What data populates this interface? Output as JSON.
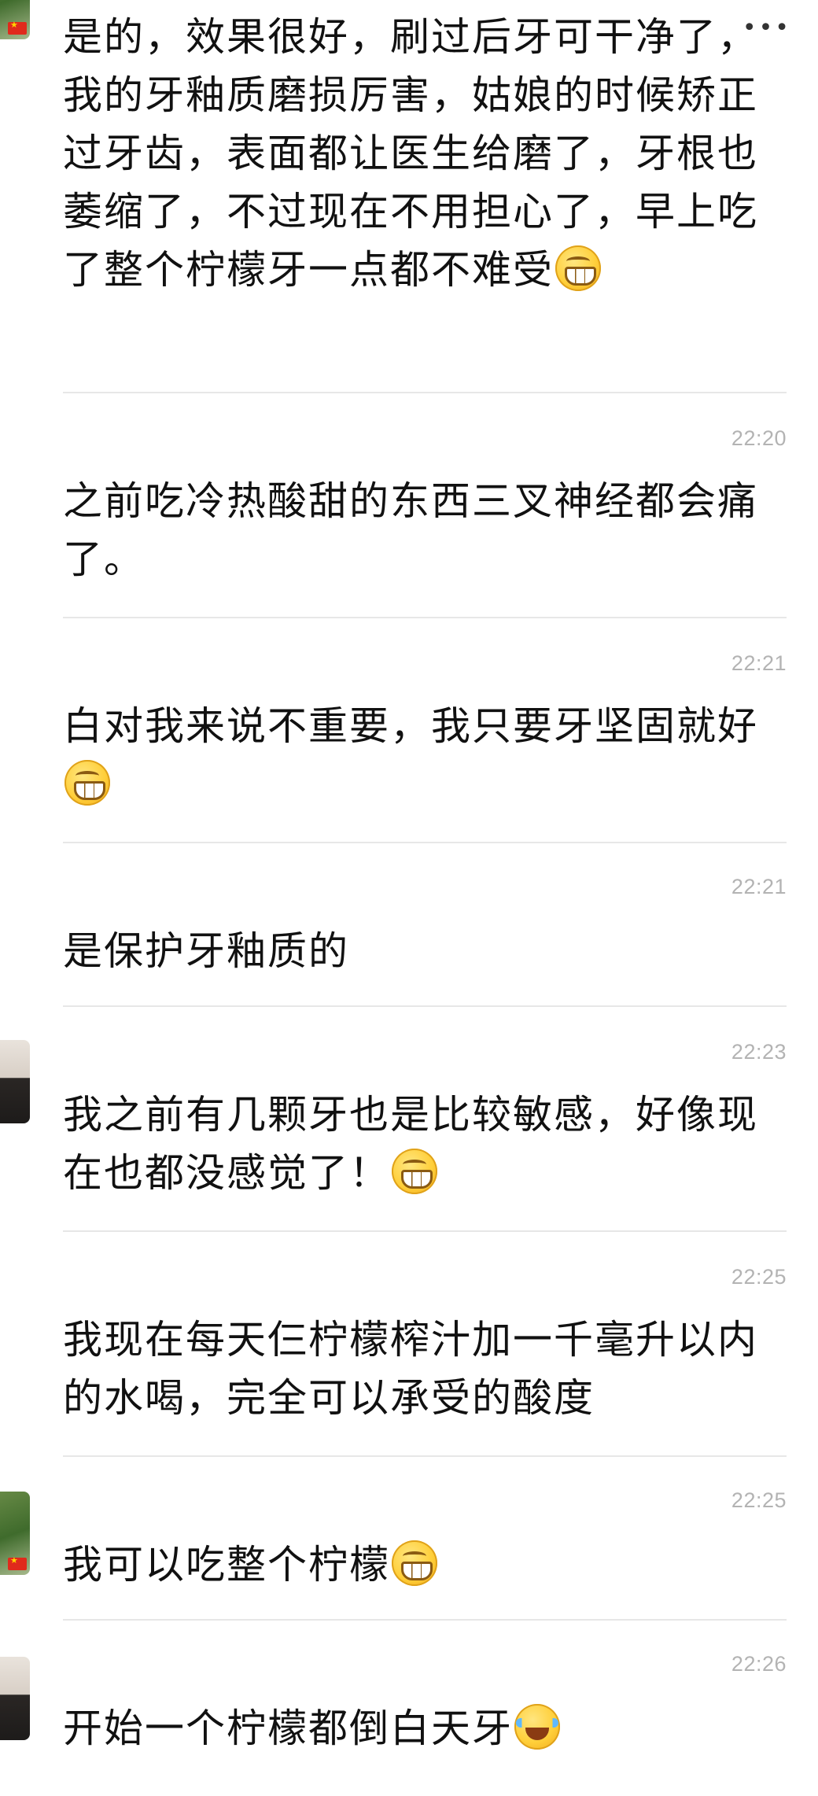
{
  "messages": [
    {
      "avatar": "plant-flag-avatar",
      "time": "",
      "text": "是的，效果很好，刷过后牙可干净了，我的牙釉质磨损厉害，姑娘的时候矫正过牙齿，表面都让医生给磨了，牙根也萎缩了，不过现在不用担心了，早上吃了整个柠檬牙一点都不难受",
      "emoji": "grin"
    },
    {
      "avatar": "",
      "time": "22:20",
      "text": "之前吃冷热酸甜的东西三叉神经都会痛了。",
      "emoji": ""
    },
    {
      "avatar": "",
      "time": "22:21",
      "text": "白对我来说不重要，我只要牙坚固就好",
      "emoji": "grin"
    },
    {
      "avatar": "",
      "time": "22:21",
      "text": "是保护牙釉质的",
      "emoji": ""
    },
    {
      "avatar": "person-avatar",
      "time": "22:23",
      "text": "我之前有几颗牙也是比较敏感，好像现在也都没感觉了！",
      "emoji": "grin"
    },
    {
      "avatar": "",
      "time": "22:25",
      "text": "我现在每天仨柠檬榨汁加一千毫升以内的水喝，完全可以承受的酸度",
      "emoji": ""
    },
    {
      "avatar": "plant-flag-avatar",
      "time": "22:25",
      "text": "我可以吃整个柠檬",
      "emoji": "grin"
    },
    {
      "avatar": "person-avatar",
      "time": "22:26",
      "text": "开始一个柠檬都倒白天牙",
      "emoji": "cry"
    }
  ],
  "more_icon": "more-dots-icon",
  "colors": {
    "time": "#b3b3b3",
    "divider": "#e7e7e7",
    "text": "#111111"
  }
}
